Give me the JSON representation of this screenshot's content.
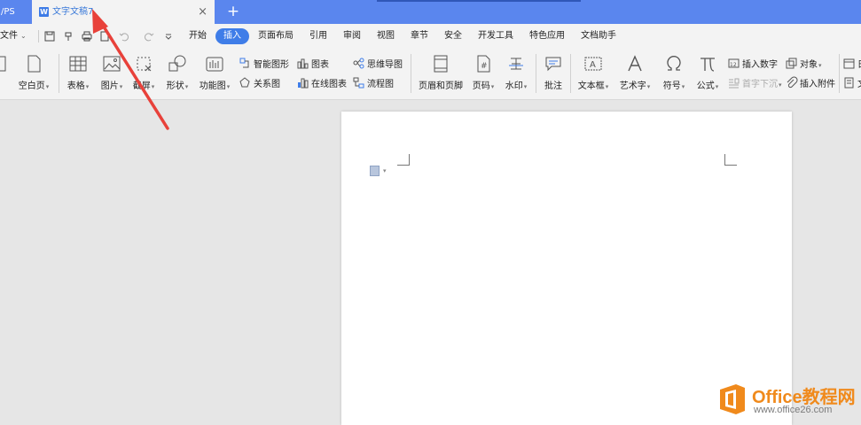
{
  "titlebar": {
    "left_tab_label": "/PS",
    "doc_tab_label": "文字文稿7",
    "doc_tab_icon": "W",
    "close_glyph": "×",
    "new_tab_glyph": "+"
  },
  "menubar": {
    "file_label": "文件",
    "tabs": [
      "开始",
      "插入",
      "页面布局",
      "引用",
      "审阅",
      "视图",
      "章节",
      "安全",
      "开发工具",
      "特色应用",
      "文档助手"
    ],
    "active_tab": "插入"
  },
  "ribbon": {
    "blank_page": "空白页",
    "table": "表格",
    "picture": "图片",
    "screenshot": "截屏",
    "shape": "形状",
    "function_chart": "功能图",
    "smart_graphic": "智能图形",
    "chart": "图表",
    "mind_map": "思维导图",
    "relation_chart": "关系图",
    "online_chart": "在线图表",
    "flowchart": "流程图",
    "header_footer": "页眉和页脚",
    "page_number": "页码",
    "watermark": "水印",
    "comment": "批注",
    "textbox": "文本框",
    "wordart": "艺术字",
    "symbol": "符号",
    "formula": "公式",
    "insert_number": "插入数字",
    "object": "对象",
    "drop_cap": "首字下沉",
    "insert_attachment": "插入附件",
    "right_edge_1": "日",
    "right_edge_2": "文"
  },
  "watermark_logo": {
    "line1": "Office教程网",
    "line2": "www.office26.com"
  },
  "colors": {
    "titlebar": "#5a86ee",
    "active_tab": "#3f7de8",
    "arrow": "#e8413a",
    "logo_orange": "#f08a1c"
  }
}
